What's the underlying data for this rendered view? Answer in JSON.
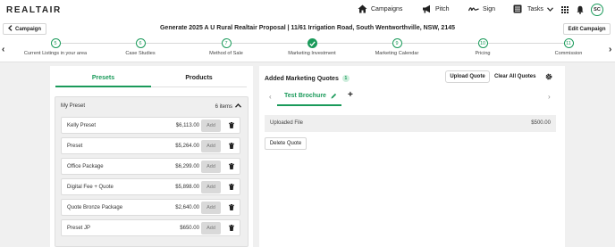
{
  "brand": {
    "logo": "REALTAIR",
    "accent": "#1a9a5a"
  },
  "nav": {
    "campaigns": "Campaigns",
    "pitch": "Pitch",
    "sign": "Sign",
    "tasks": "Tasks",
    "avatar_initials": "SC"
  },
  "header": {
    "back_label": "Campaign",
    "title": "Generate 2025 A U Rural Realtair Proposal | 11/61 Irrigation Road, South Wentworthville, NSW, 2145",
    "edit_label": "Edit Campaign"
  },
  "stepper": {
    "steps": [
      {
        "num": "5",
        "label": "Current Listings in your area",
        "done": false
      },
      {
        "num": "6",
        "label": "Case Studies",
        "done": false
      },
      {
        "num": "7",
        "label": "Method of Sale",
        "done": false
      },
      {
        "num": "",
        "label": "Marketing Investment",
        "done": true
      },
      {
        "num": "9",
        "label": "Marketing Calendar",
        "done": false
      },
      {
        "num": "10",
        "label": "Pricing",
        "done": false
      },
      {
        "num": "11",
        "label": "Commission",
        "done": false
      }
    ]
  },
  "left": {
    "tabs": [
      "Presets",
      "Products"
    ],
    "preset_group": {
      "name": "My Preset",
      "count": "6 items"
    },
    "add_label": "Add",
    "presets": [
      {
        "name": "Kelly Preset",
        "price": "$6,113.00"
      },
      {
        "name": "Preset",
        "price": "$5,264.00"
      },
      {
        "name": "Office Package",
        "price": "$6,299.00"
      },
      {
        "name": "Digital Fee + Quote",
        "price": "$5,898.00"
      },
      {
        "name": "Quote Bronze Package",
        "price": "$2,640.00"
      },
      {
        "name": "Preset JP",
        "price": "$650.00"
      }
    ]
  },
  "right": {
    "title": "Added Marketing Quotes",
    "count": "1",
    "upload_label": "Upload Quote",
    "clear_label": "Clear All Quotes",
    "quote_tab": "Test Brochure",
    "file_label": "Uploaded File",
    "file_price": "$500.00",
    "delete_label": "Delete Quote"
  }
}
